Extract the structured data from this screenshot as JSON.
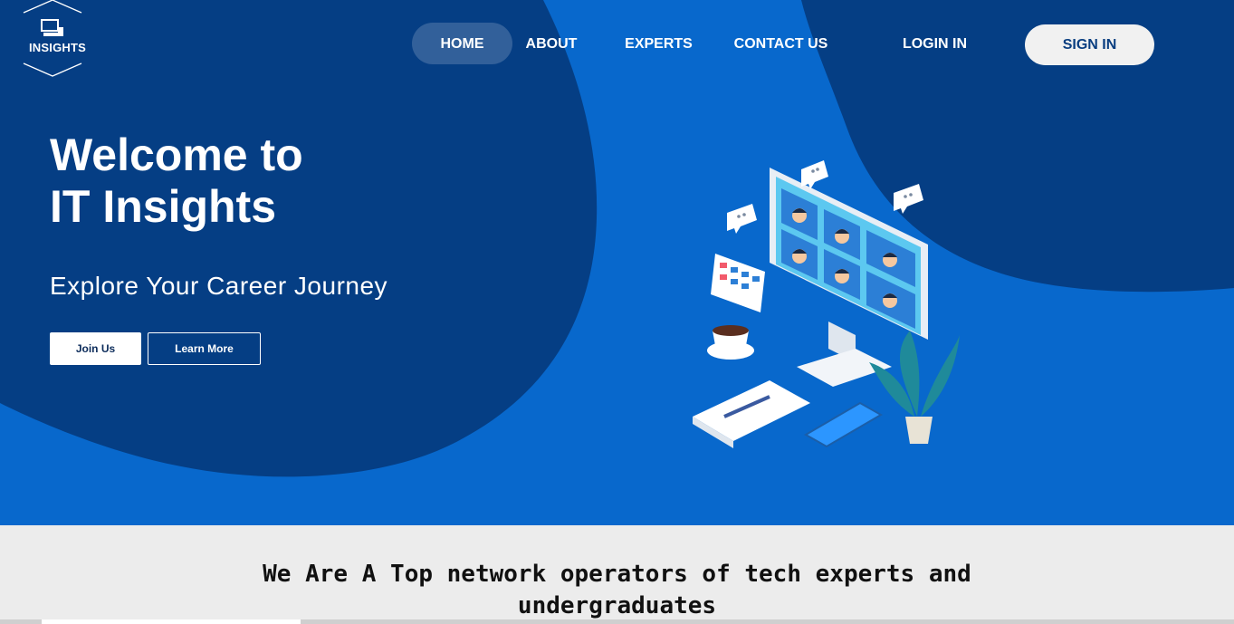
{
  "brand": {
    "name": "INSIGHTS"
  },
  "nav": {
    "items": [
      {
        "label": "HOME",
        "active": true
      },
      {
        "label": "ABOUT"
      },
      {
        "label": "EXPERTS"
      },
      {
        "label": "CONTACT US"
      },
      {
        "label": "LOGIN IN"
      }
    ],
    "signin_label": "SIGN IN"
  },
  "hero": {
    "title_line1": "Welcome to",
    "title_line2": "IT Insights",
    "subtitle": "Explore Your Career Journey",
    "join_label": "Join Us",
    "learn_label": "Learn More"
  },
  "band": {
    "line1": "We Are A Top network operators of tech experts and",
    "line2": "undergraduates"
  },
  "colors": {
    "dark_blue": "#053e84",
    "bright_blue": "#0868cc",
    "band_bg": "#ececec",
    "white": "#ffffff"
  }
}
